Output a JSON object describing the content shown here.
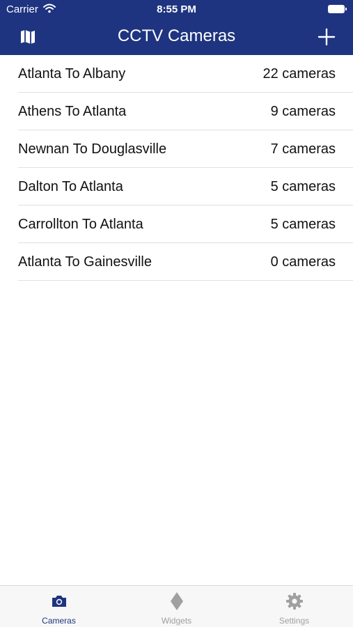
{
  "status_bar": {
    "carrier": "Carrier",
    "time": "8:55 PM"
  },
  "nav": {
    "title": "CCTV Cameras",
    "left_icon": "map-icon",
    "right_icon": "plus-icon"
  },
  "routes": [
    {
      "name": "Atlanta To Albany",
      "count": "22 cameras"
    },
    {
      "name": "Athens To Atlanta",
      "count": "9 cameras"
    },
    {
      "name": "Newnan To Douglasville",
      "count": "7 cameras"
    },
    {
      "name": "Dalton To Atlanta",
      "count": "5 cameras"
    },
    {
      "name": "Carrollton To Atlanta",
      "count": "5 cameras"
    },
    {
      "name": "Atlanta To Gainesville",
      "count": "0 cameras"
    }
  ],
  "tabs": [
    {
      "label": "Cameras",
      "icon": "camera-icon",
      "active": true
    },
    {
      "label": "Widgets",
      "icon": "diamond-icon",
      "active": false
    },
    {
      "label": "Settings",
      "icon": "gear-icon",
      "active": false
    }
  ],
  "colors": {
    "nav_background": "#1f3480",
    "active_tab": "#1f3480",
    "inactive_tab": "#a0a0a0"
  }
}
